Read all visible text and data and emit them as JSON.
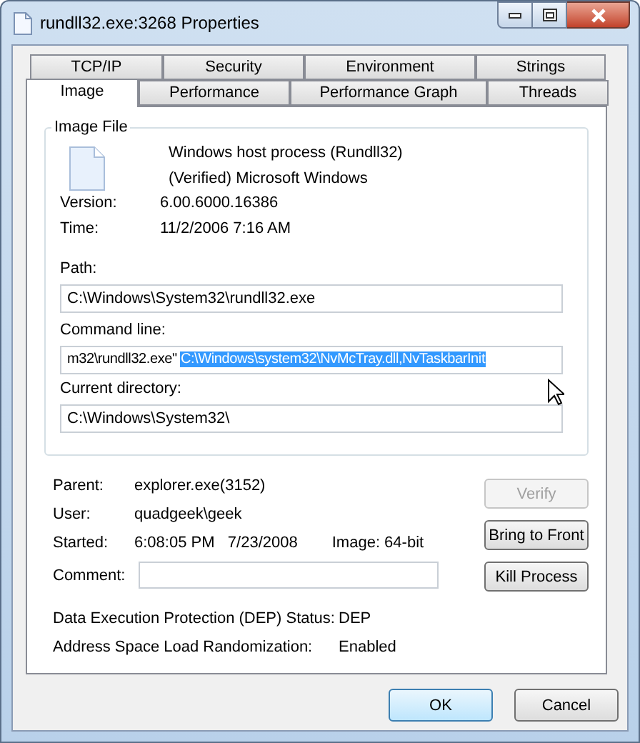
{
  "window": {
    "title": "rundll32.exe:3268 Properties"
  },
  "tab_rows": [
    [
      {
        "label": "TCP/IP",
        "selected": false
      },
      {
        "label": "Security",
        "selected": false
      },
      {
        "label": "Environment",
        "selected": false
      },
      {
        "label": "Strings",
        "selected": false
      }
    ],
    [
      {
        "label": "Image",
        "selected": true
      },
      {
        "label": "Performance",
        "selected": false
      },
      {
        "label": "Performance Graph",
        "selected": false
      },
      {
        "label": "Threads",
        "selected": false
      }
    ]
  ],
  "image_file": {
    "title": "Image File",
    "description": "Windows host process (Rundll32)",
    "company": "(Verified) Microsoft Windows",
    "info": [
      {
        "label": "Version:",
        "value": "6.00.6000.16386"
      },
      {
        "label": "Time:",
        "value": "11/2/2006 7:16 AM"
      }
    ],
    "path": {
      "label": "Path:",
      "value": "C:\\Windows\\System32\\rundll32.exe"
    },
    "command_line": {
      "label": "Command line:",
      "value": "m32\\rundll32.exe\" ",
      "selected_text": "C:\\Windows\\system32\\NvMcTray.dll,NvTaskbarInit"
    },
    "current_directory": {
      "label": "Current directory:",
      "value": "C:\\Windows\\System32\\"
    }
  },
  "details": [
    {
      "label": "Parent:",
      "value": "explorer.exe(3152)"
    },
    {
      "label": "User:",
      "value": "quadgeek\\geek"
    },
    {
      "label": "Started:",
      "value": "6:08:05 PM   7/23/2008",
      "extra": "Image: 64-bit"
    }
  ],
  "comment": {
    "label": "Comment:"
  },
  "side_buttons": [
    {
      "label": "Verify",
      "disabled": true
    },
    {
      "label": "Bring to Front",
      "disabled": false
    },
    {
      "label": "Kill Process",
      "disabled": false
    }
  ],
  "security": [
    {
      "label": "Data Execution Protection (DEP) Status:",
      "value": "DEP"
    },
    {
      "label": "Address Space Load Randomization:",
      "value": "Enabled"
    }
  ],
  "buttons": [
    {
      "label": "OK",
      "default": true
    },
    {
      "label": "Cancel",
      "default": false
    }
  ]
}
